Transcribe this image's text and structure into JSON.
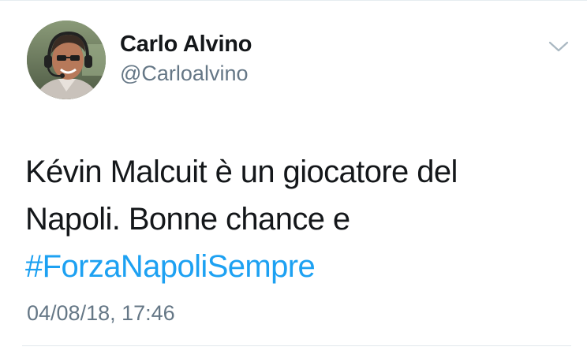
{
  "tweet": {
    "author": {
      "display_name": "Carlo Alvino",
      "handle": "@Carloalvino"
    },
    "text_line_1": "Kévin Malcuit è un giocatore del",
    "text_line_2": "Napoli. Bonne chance e",
    "hashtag": "#ForzaNapoliSempre",
    "timestamp": "04/08/18, 17:46"
  },
  "icons": {
    "menu": "chevron-down-icon"
  },
  "colors": {
    "text": "#14171a",
    "secondary": "#657786",
    "link": "#1da1f2",
    "divider": "#e1e8ed"
  }
}
